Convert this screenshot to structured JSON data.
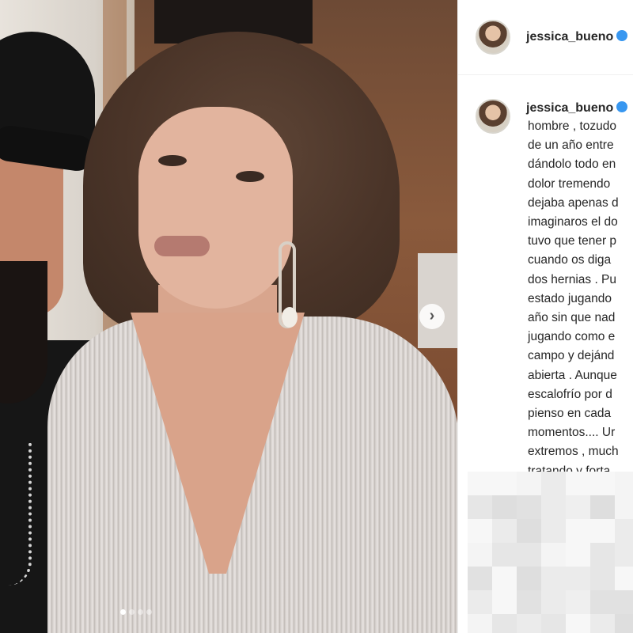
{
  "post": {
    "carousel": {
      "next_icon": "chevron-right-icon",
      "next_glyph": "›",
      "page_count": 4,
      "current_page": 1
    }
  },
  "sidebar": {
    "header": {
      "username": "jessica_bueno",
      "verified_icon": "verified-badge-icon"
    },
    "caption": {
      "username": "jessica_bueno",
      "lines": [
        "hombre , tozudo",
        "de un año entre",
        "dándolo todo en",
        "dolor tremendo",
        "dejaba apenas d",
        "imaginaros el do",
        "tuvo que tener p",
        "cuando os diga",
        "dos hernias . Pu",
        "estado jugando",
        "año sin que nad",
        "jugando como e",
        "campo y dejánd",
        "abierta . Aunque",
        "escalofrío por d",
        "pienso en cada",
        "momentos.... Ur",
        "extremos , much",
        "tratando y forta"
      ]
    }
  },
  "colors": {
    "accent_verified": "#3897f0",
    "text": "#262626",
    "divider": "#efefef"
  }
}
